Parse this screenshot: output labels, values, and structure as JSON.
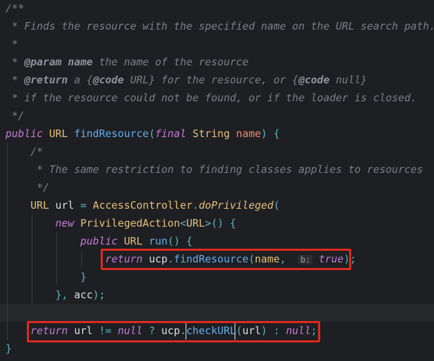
{
  "editor": {
    "colors": {
      "highlight_box": "#e02a1f",
      "background": "#1e1f22"
    },
    "lines": [
      [
        [
          "cm",
          "/**"
        ]
      ],
      [
        [
          "cm",
          " * Finds the resource with the specified name on the URL search path."
        ]
      ],
      [
        [
          "cm",
          " *"
        ]
      ],
      [
        [
          "cm",
          " * "
        ],
        [
          "cmt",
          "@param"
        ],
        [
          "cm",
          " "
        ],
        [
          "cmt",
          "name"
        ],
        [
          "cm",
          " the name of the resource"
        ]
      ],
      [
        [
          "cm",
          " * "
        ],
        [
          "cmt",
          "@return"
        ],
        [
          "cm",
          " a {"
        ],
        [
          "cmt",
          "@code"
        ],
        [
          "cm",
          " URL} for the resource, or {"
        ],
        [
          "cmt",
          "@code"
        ],
        [
          "cm",
          " null}"
        ]
      ],
      [
        [
          "cm",
          " * if the resource could not be found, or if the loader is closed."
        ]
      ],
      [
        [
          "cm",
          " */"
        ]
      ],
      [
        [
          "kw",
          "public"
        ],
        [
          "id",
          " "
        ],
        [
          "ty",
          "URL"
        ],
        [
          "id",
          " "
        ],
        [
          "fn",
          "findResource"
        ],
        [
          "pu",
          "("
        ],
        [
          "kw",
          "final"
        ],
        [
          "id",
          " "
        ],
        [
          "ty",
          "String"
        ],
        [
          "id",
          " "
        ],
        [
          "pa",
          "name"
        ],
        [
          "pu",
          ")"
        ],
        [
          "id",
          " "
        ],
        [
          "pu",
          "{"
        ]
      ],
      [
        [
          "id",
          "    "
        ],
        [
          "cm",
          "/*"
        ]
      ],
      [
        [
          "id",
          "    "
        ],
        [
          "cm",
          " * The same restriction to finding classes applies to resources"
        ]
      ],
      [
        [
          "id",
          "    "
        ],
        [
          "cm",
          " */"
        ]
      ],
      [
        [
          "id",
          "    "
        ],
        [
          "ty",
          "URL"
        ],
        [
          "id",
          " url "
        ],
        [
          "pu",
          "="
        ],
        [
          "id",
          " "
        ],
        [
          "ty",
          "AccessController"
        ],
        [
          "pu",
          "."
        ],
        [
          "tyi",
          "doPrivileged"
        ],
        [
          "pu",
          "("
        ]
      ],
      [
        [
          "id",
          "        "
        ],
        [
          "kw",
          "new"
        ],
        [
          "id",
          " "
        ],
        [
          "ty",
          "PrivilegedAction"
        ],
        [
          "pu",
          "<"
        ],
        [
          "ty",
          "URL"
        ],
        [
          "pu",
          ">()"
        ],
        [
          "id",
          " "
        ],
        [
          "pu",
          "{"
        ]
      ],
      [
        [
          "id",
          "            "
        ],
        [
          "kw",
          "public"
        ],
        [
          "id",
          " "
        ],
        [
          "ty",
          "URL"
        ],
        [
          "id",
          " "
        ],
        [
          "fn",
          "run"
        ],
        [
          "pu",
          "()"
        ],
        [
          "id",
          " "
        ],
        [
          "pu",
          "{"
        ]
      ],
      [
        [
          "id",
          "                "
        ],
        [
          "kw",
          "return"
        ],
        [
          "id",
          " ucp"
        ],
        [
          "pu",
          "."
        ],
        [
          "fn",
          "findResource"
        ],
        [
          "pu",
          "("
        ],
        [
          "arg",
          "name"
        ],
        [
          "pu",
          ","
        ],
        [
          "id",
          "  "
        ],
        [
          "hint",
          "b:"
        ],
        [
          "id",
          " "
        ],
        [
          "kw",
          "true"
        ],
        [
          "pu",
          ");"
        ]
      ],
      [
        [
          "id",
          "            "
        ],
        [
          "pu",
          "}"
        ]
      ],
      [
        [
          "id",
          "        "
        ],
        [
          "pu",
          "},"
        ],
        [
          "id",
          " acc"
        ],
        [
          "pu",
          ");"
        ]
      ],
      [],
      [
        [
          "id",
          "    "
        ],
        [
          "kw",
          "return"
        ],
        [
          "id",
          " url "
        ],
        [
          "pu",
          "!="
        ],
        [
          "id",
          " "
        ],
        [
          "kw",
          "null"
        ],
        [
          "id",
          " "
        ],
        [
          "pu",
          "?"
        ],
        [
          "id",
          " ucp"
        ],
        [
          "pu",
          "."
        ],
        [
          "fn",
          "checkURL"
        ],
        [
          "pu",
          "("
        ],
        [
          "id",
          "url"
        ],
        [
          "pu",
          ")"
        ],
        [
          "id",
          " "
        ],
        [
          "pu",
          ":"
        ],
        [
          "id",
          " "
        ],
        [
          "kw",
          "null"
        ],
        [
          "pu",
          ";"
        ]
      ],
      [
        [
          "pu",
          "}"
        ]
      ]
    ]
  }
}
